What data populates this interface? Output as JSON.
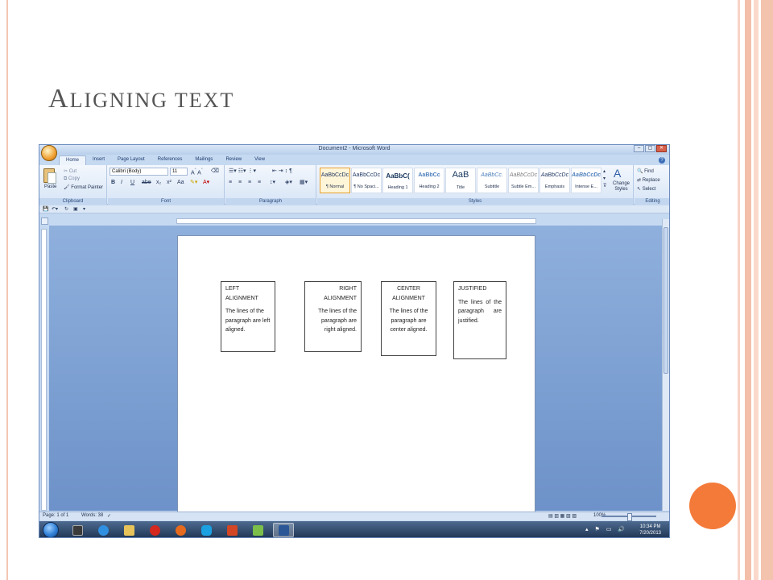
{
  "slide": {
    "title_first": "A",
    "title_rest": "ligning text"
  },
  "window": {
    "title": "Document2 - Microsoft Word",
    "controls": [
      "–",
      "▢",
      "✕"
    ]
  },
  "ribbon_tabs": [
    "Home",
    "Insert",
    "Page Layout",
    "References",
    "Mailings",
    "Review",
    "View"
  ],
  "clipboard": {
    "paste": "Paste",
    "cut": "Cut",
    "copy": "Copy",
    "format_painter": "Format Painter",
    "label": "Clipboard"
  },
  "font": {
    "name": "Calibri (Body)",
    "size": "11",
    "label": "Font",
    "buttons": [
      "B",
      "I",
      "U",
      "abe",
      "x₂",
      "x²",
      "Aa"
    ]
  },
  "paragraph": {
    "label": "Paragraph"
  },
  "styles": {
    "label": "Styles",
    "items": [
      {
        "sample": "AaBbCcDc",
        "name": "¶ Normal"
      },
      {
        "sample": "AaBbCcDc",
        "name": "¶ No Spaci..."
      },
      {
        "sample": "AaBbC(",
        "name": "Heading 1"
      },
      {
        "sample": "AaBbCc",
        "name": "Heading 2"
      },
      {
        "sample": "AaB",
        "name": "Title"
      },
      {
        "sample": "AaBbCc.",
        "name": "Subtitle"
      },
      {
        "sample": "AaBbCcDc",
        "name": "Subtle Em..."
      },
      {
        "sample": "AaBbCcDc",
        "name": "Emphasis"
      },
      {
        "sample": "AaBbCcDc",
        "name": "Intense E..."
      }
    ],
    "change_styles": "Change Styles"
  },
  "editing": {
    "label": "Editing",
    "find": "Find",
    "replace": "Replace",
    "select": "Select"
  },
  "boxes": [
    {
      "heading": "LEFT ALIGNMENT",
      "body": "The lines of the paragraph are left aligned."
    },
    {
      "heading": "RIGHT ALIGNMENT",
      "body": "The lines of the paragraph are right aligned."
    },
    {
      "heading": "CENTER ALIGNMENT",
      "body": "The lines of the paragraph are center aligned."
    },
    {
      "heading": "JUSTIFIED",
      "body": "The lines of the paragraph are justified."
    }
  ],
  "status": {
    "page": "Page: 1 of 1",
    "words": "Words: 38",
    "zoom": "100%"
  },
  "taskbar": {
    "time": "10:34 PM",
    "date": "7/20/2013"
  }
}
